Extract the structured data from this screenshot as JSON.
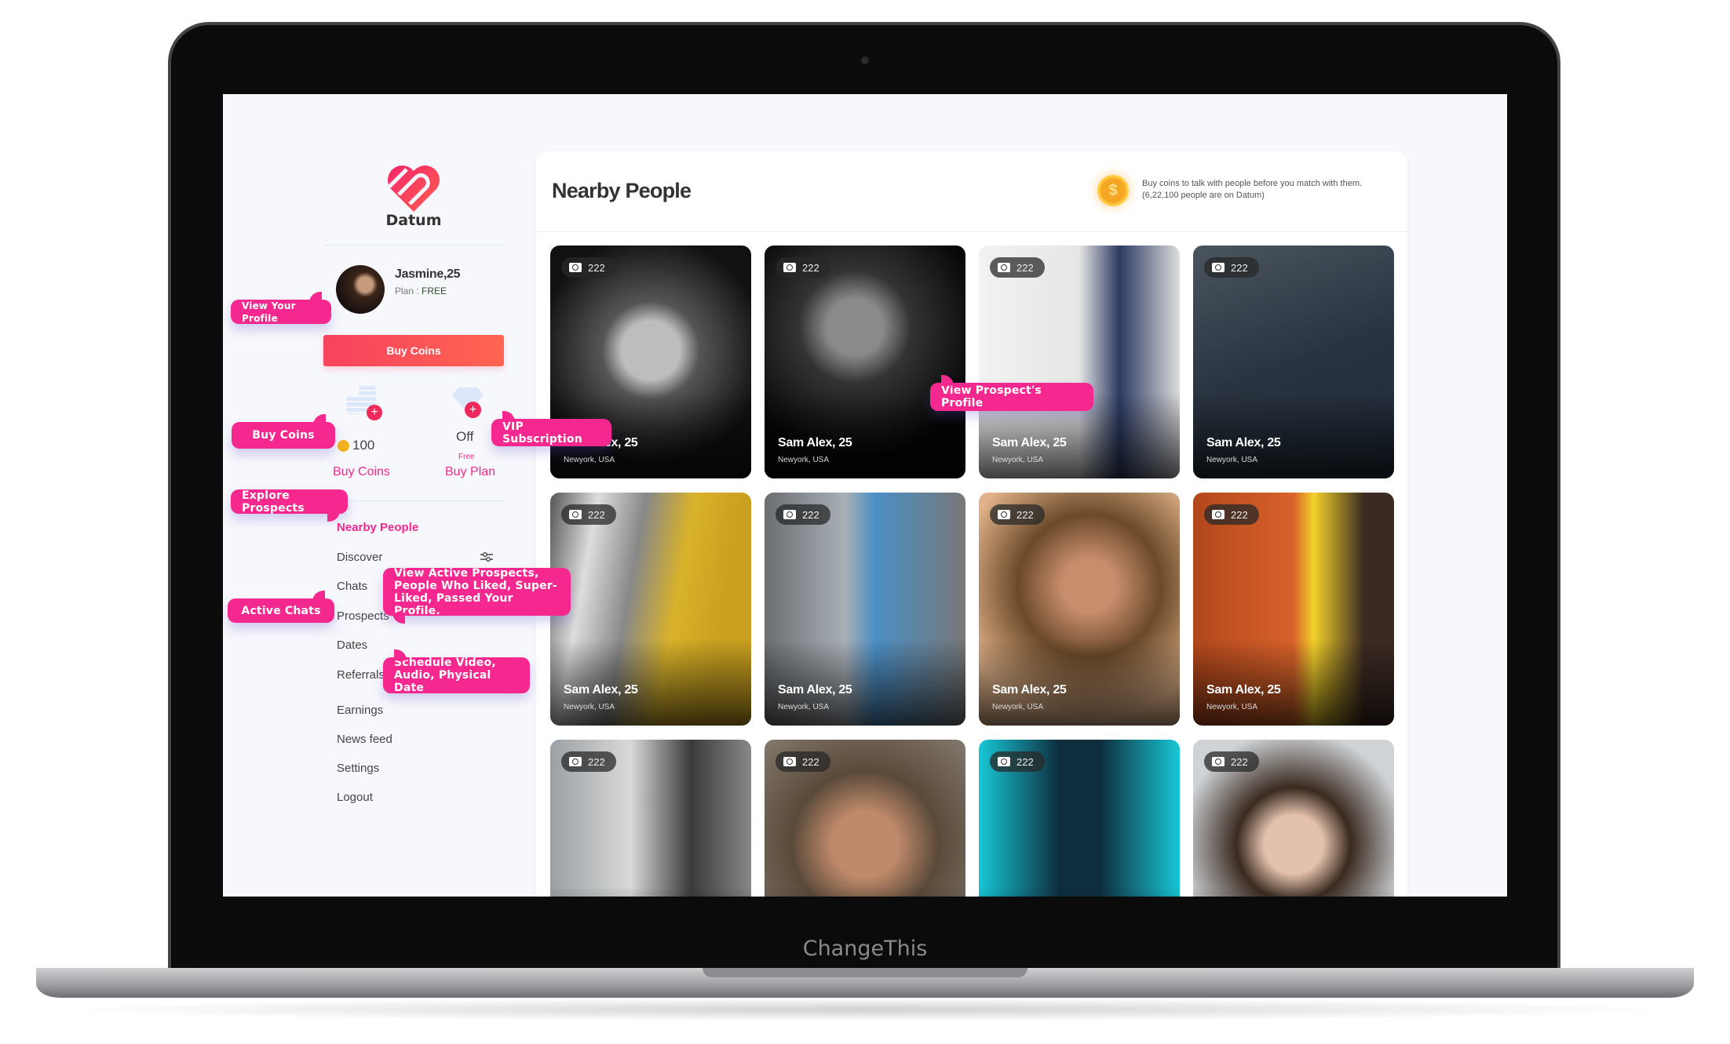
{
  "device_label": "ChangeThis",
  "brand": {
    "name": "Datum",
    "accent": "#f5288f",
    "button_gradient": [
      "#f7435f",
      "#ff6450"
    ]
  },
  "profile": {
    "name": "Jasmine,25",
    "plan_label": "Plan : ",
    "plan_value": "FREE"
  },
  "buy_coins_button": "Buy Coins",
  "coins": {
    "icon": "coin-stack-icon",
    "count": "100",
    "link": "Buy Coins"
  },
  "plan": {
    "icon": "diamond-icon",
    "status": "Off",
    "tier": "Free",
    "link": "Buy Plan"
  },
  "menu": [
    {
      "label": "Nearby People",
      "active": true
    },
    {
      "label": "Discover"
    },
    {
      "label": "Chats"
    },
    {
      "label": "Prospects"
    },
    {
      "label": "Dates"
    },
    {
      "label": "Referrals"
    },
    {
      "label": "Earnings"
    },
    {
      "label": "News feed"
    },
    {
      "label": "Settings"
    },
    {
      "label": "Logout"
    }
  ],
  "callouts": {
    "view_profile": "View Your Profile",
    "buy_coins": "Buy Coins",
    "vip": "VIP Subscription",
    "explore": "Explore Prospects",
    "active_chats": "Active Chats",
    "prospects": "View Active Prospects, People Who Liked, Super-Liked, Passed Your Profile.",
    "dates": "Schedule Video, Audio, Physical Date",
    "view_prospect": "View Prospect's Profile"
  },
  "main": {
    "title": "Nearby People",
    "coin_info_line1": "Buy coins to talk with people before you match with them.",
    "coin_info_line2": "(6,22,100 people are on Datum)"
  },
  "people": [
    {
      "name": "Sam Alex, 25",
      "location": "Newyork, USA",
      "photos": "222"
    },
    {
      "name": "Sam Alex, 25",
      "location": "Newyork, USA",
      "photos": "222"
    },
    {
      "name": "Sam Alex, 25",
      "location": "Newyork, USA",
      "photos": "222"
    },
    {
      "name": "Sam Alex, 25",
      "location": "Newyork, USA",
      "photos": "222"
    },
    {
      "name": "Sam Alex, 25",
      "location": "Newyork, USA",
      "photos": "222"
    },
    {
      "name": "Sam Alex, 25",
      "location": "Newyork, USA",
      "photos": "222"
    },
    {
      "name": "Sam Alex, 25",
      "location": "Newyork, USA",
      "photos": "222"
    },
    {
      "name": "Sam Alex, 25",
      "location": "Newyork, USA",
      "photos": "222"
    },
    {
      "name": "",
      "location": "",
      "photos": "222"
    },
    {
      "name": "",
      "location": "",
      "photos": "222"
    },
    {
      "name": "",
      "location": "",
      "photos": "222"
    },
    {
      "name": "",
      "location": "",
      "photos": "222"
    }
  ]
}
